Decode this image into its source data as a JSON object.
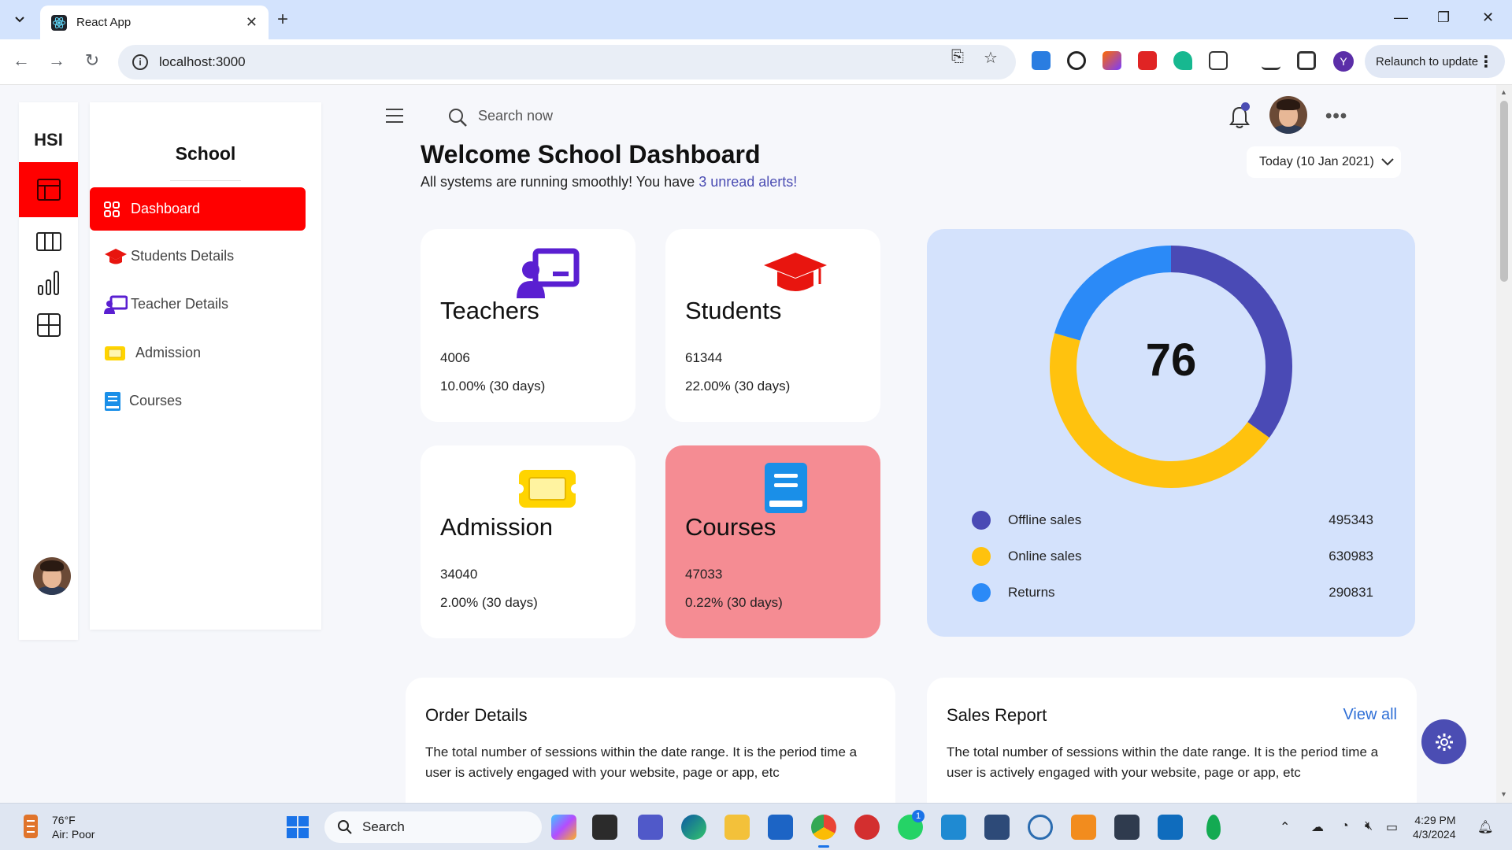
{
  "browser": {
    "tab_title": "React App",
    "url": "localhost:3000",
    "relaunch_label": "Relaunch to update",
    "profile_initial": "Y"
  },
  "iconbar": {
    "brand": "HSI"
  },
  "sidebar": {
    "title": "School",
    "items": [
      {
        "label": "Dashboard",
        "icon": "grid-icon"
      },
      {
        "label": "Students Details",
        "icon": "graduation-cap-icon"
      },
      {
        "label": "Teacher Details",
        "icon": "teacher-icon"
      },
      {
        "label": "Admission",
        "icon": "ticket-icon"
      },
      {
        "label": "Courses",
        "icon": "book-icon"
      }
    ]
  },
  "header": {
    "search_placeholder": "Search now",
    "title": "Welcome School Dashboard",
    "subtitle": "All systems are running smoothly! You have ",
    "alert_link": "3 unread alerts!",
    "date": "Today (10 Jan 2021)"
  },
  "cards": [
    {
      "title": "Teachers",
      "value": "4006",
      "change": "10.00% (30 days)",
      "icon": "teacher-icon",
      "color": "#5a1fd1"
    },
    {
      "title": "Students",
      "value": "61344",
      "change": "22.00% (30 days)",
      "icon": "graduation-cap-icon",
      "color": "#e8150f"
    },
    {
      "title": "Admission",
      "value": "34040",
      "change": "2.00% (30 days)",
      "icon": "ticket-icon",
      "color": "#ffd400"
    },
    {
      "title": "Courses",
      "value": "47033",
      "change": "0.22% (30 days)",
      "icon": "book-icon",
      "color": "#1a8fe8"
    }
  ],
  "chart_data": {
    "type": "pie",
    "center_value": "76",
    "series": [
      {
        "name": "Offline sales",
        "value": 495343,
        "color": "#4a4ab5"
      },
      {
        "name": "Online sales",
        "value": 630983,
        "color": "#ffc20e"
      },
      {
        "name": "Returns",
        "value": 290831,
        "color": "#2b8af7"
      }
    ]
  },
  "legend_values": [
    "495343",
    "630983",
    "290831"
  ],
  "panels": {
    "order": {
      "title": "Order Details",
      "text": "The total number of sessions within the date range. It is the period time a user is actively engaged with your website, page or app, etc"
    },
    "sales": {
      "title": "Sales Report",
      "link": "View all",
      "text": "The total number of sessions within the date range. It is the period time a user is actively engaged with your website, page or app, etc"
    }
  },
  "taskbar": {
    "weather_temp": "76°F",
    "weather_desc": "Air: Poor",
    "search_label": "Search",
    "time": "4:29 PM",
    "date": "4/3/2024",
    "whatsapp_badge": "1"
  }
}
